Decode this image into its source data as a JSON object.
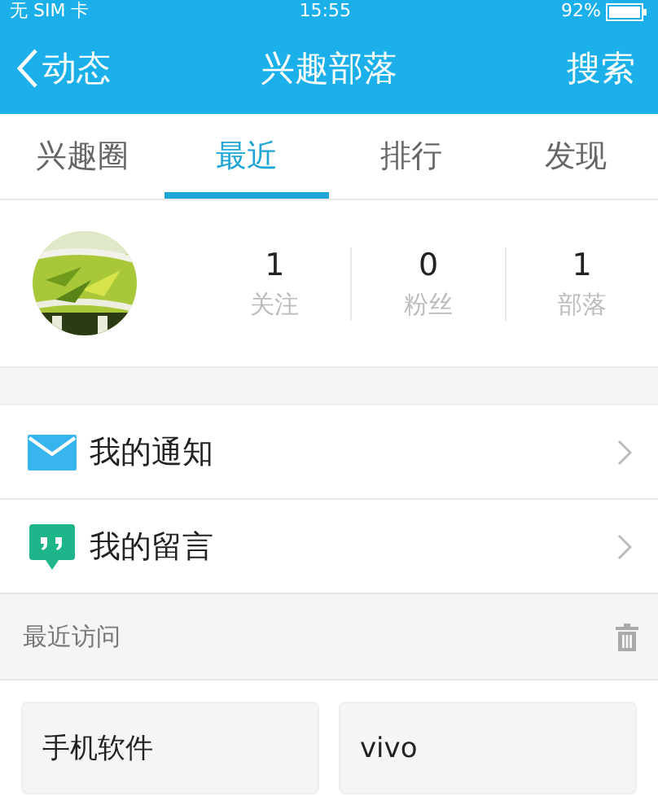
{
  "status_bar": {
    "carrier": "无 SIM 卡",
    "time": "15:55",
    "battery": "92%"
  },
  "nav": {
    "back": "动态",
    "title": "兴趣部落",
    "action": "搜索"
  },
  "tabs": [
    {
      "label": "兴趣圈",
      "selected": false
    },
    {
      "label": "最近",
      "selected": true
    },
    {
      "label": "排行",
      "selected": false
    },
    {
      "label": "发现",
      "selected": false
    }
  ],
  "profile": {
    "stats": [
      {
        "value": "1",
        "label": "关注"
      },
      {
        "value": "0",
        "label": "粉丝"
      },
      {
        "value": "1",
        "label": "部落"
      }
    ]
  },
  "menu": [
    {
      "kind": "mail",
      "label": "我的通知"
    },
    {
      "kind": "quote",
      "label": "我的留言"
    }
  ],
  "recent": {
    "title": "最近访问",
    "items": [
      "手机软件",
      "vivo"
    ]
  }
}
